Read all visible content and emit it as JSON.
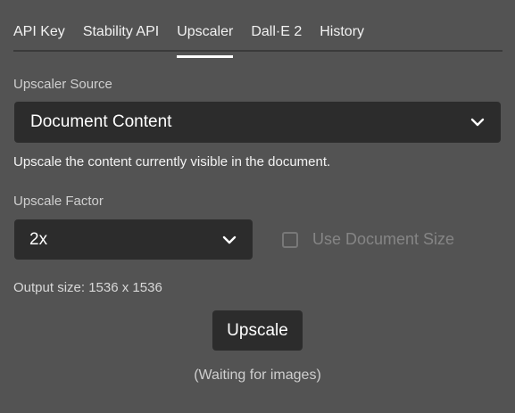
{
  "tabs": [
    {
      "label": "API Key",
      "active": false
    },
    {
      "label": "Stability API",
      "active": false
    },
    {
      "label": "Upscaler",
      "active": true
    },
    {
      "label": "Dall·E 2",
      "active": false
    },
    {
      "label": "History",
      "active": false
    }
  ],
  "upscaler_source": {
    "label": "Upscaler Source",
    "selected": "Document Content",
    "description": "Upscale the content currently visible in the document."
  },
  "upscale_factor": {
    "label": "Upscale Factor",
    "selected": "2x"
  },
  "use_document_size": {
    "label": "Use Document Size",
    "checked": false,
    "enabled": false
  },
  "output_size": "Output size: 1536 x 1536",
  "upscale_button": "Upscale",
  "status": "(Waiting for images)",
  "colors": {
    "background": "#535353",
    "control": "#2c2c2c",
    "text": "#ffffff"
  },
  "icons": {
    "dropdown": "chevron-down-icon",
    "checkbox": "checkbox-unchecked"
  }
}
